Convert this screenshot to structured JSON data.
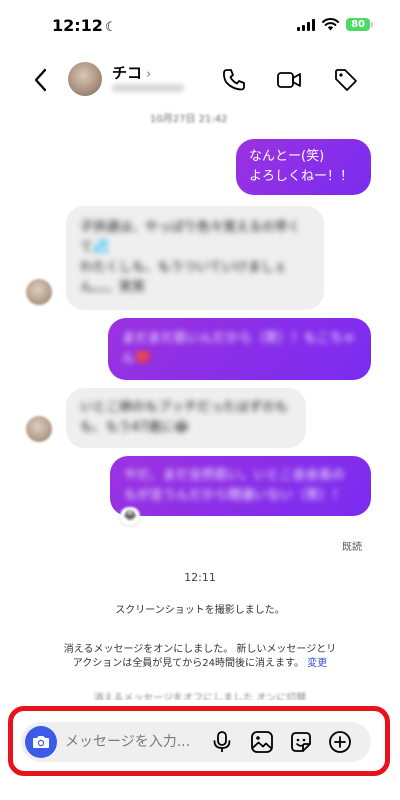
{
  "status_bar": {
    "time": "12:12",
    "moon": "☾",
    "battery": "80"
  },
  "header": {
    "contact_name": "チコ",
    "chevron": "›"
  },
  "messages": [
    {
      "side": "out",
      "text": "なんとー(笑)\nよろしくねー！！",
      "blurred": false
    },
    {
      "side": "in",
      "text": "子供達は、やっぱり色々覚えるの早くて💦\nわたくしも、もうついていけましぇん。。。笑笑",
      "blurred": true
    },
    {
      "side": "out",
      "text": "まだまだ若いんだから（笑）！もこちゃん❤️",
      "blurred": true
    },
    {
      "side": "in",
      "text": "いとこ姉のもブッチだったはずのもも、もう47歳に😂",
      "blurred": true
    },
    {
      "side": "out",
      "text": "やだ、まだ全然若い。いとこ会会長のもが言うんだから間違いない（笑）！",
      "blurred": true
    }
  ],
  "reaction_emoji": "😂",
  "read_receipt": "既読",
  "timestamp": "12:11",
  "system_messages": {
    "screenshot": "スクリーンショットを撮影しました。",
    "vanish_mode": "消えるメッセージをオンにしました。 新しいメッセージとリアクションは全員が見てから24時間後に消えます。",
    "vanish_mode_link": "変更"
  },
  "composer": {
    "placeholder": "メッセージを入力..."
  },
  "colors": {
    "outgoing_bubble": "#8a2ff0",
    "camera_button": "#3c5be8",
    "highlight": "#e8121a"
  }
}
